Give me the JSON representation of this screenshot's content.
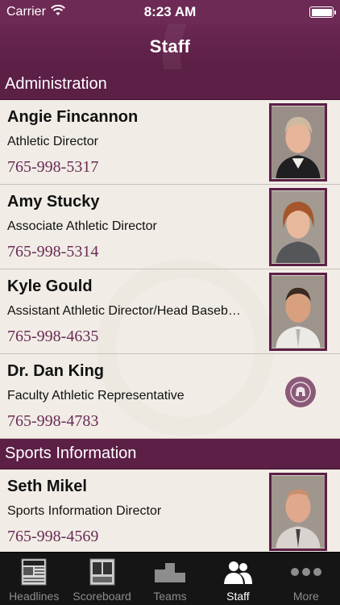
{
  "status_bar": {
    "carrier": "Carrier",
    "time": "8:23 AM"
  },
  "nav": {
    "title": "Staff"
  },
  "sections": [
    {
      "header": "Administration",
      "staff": [
        {
          "name": "Angie Fincannon",
          "title": "Athletic Director",
          "phone": "765-998-5317",
          "photo": "photo"
        },
        {
          "name": "Amy Stucky",
          "title": "Associate Athletic Director",
          "phone": "765-998-5314",
          "photo": "photo"
        },
        {
          "name": "Kyle Gould",
          "title": "Assistant Athletic Director/Head Baseb…",
          "phone": "765-998-4635",
          "photo": "photo"
        },
        {
          "name": "Dr. Dan King",
          "title": "Faculty Athletic Representative",
          "phone": "765-998-4783",
          "photo": "logo-placeholder"
        }
      ]
    },
    {
      "header": "Sports Information",
      "staff": [
        {
          "name": "Seth Mikel",
          "title": "Sports Information Director",
          "phone": "765-998-4569",
          "photo": "photo"
        }
      ]
    }
  ],
  "tabs": [
    {
      "label": "Headlines",
      "icon": "newspaper-icon"
    },
    {
      "label": "Scoreboard",
      "icon": "scoreboard-icon"
    },
    {
      "label": "Teams",
      "icon": "podium-icon"
    },
    {
      "label": "Staff",
      "icon": "people-icon",
      "active": true
    },
    {
      "label": "More",
      "icon": "more-dots-icon"
    }
  ],
  "colors": {
    "brand": "#5c1f46",
    "phone": "#6b2a55",
    "tab_bar": "#151515"
  }
}
